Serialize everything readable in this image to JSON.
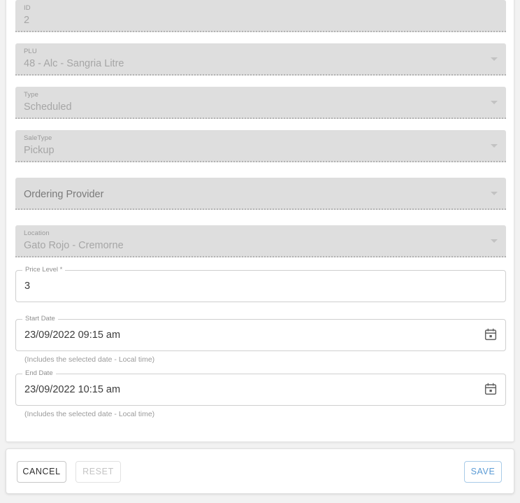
{
  "form": {
    "fields": [
      {
        "name": "id",
        "label": "ID",
        "value": "2",
        "type": "filled",
        "disabled": true,
        "arrow": false
      },
      {
        "name": "plu",
        "label": "PLU",
        "value": "48 - Alc - Sangria Litre",
        "type": "filled",
        "disabled": true,
        "arrow": true
      },
      {
        "name": "type",
        "label": "Type",
        "value": "Scheduled",
        "type": "filled",
        "disabled": true,
        "arrow": true
      },
      {
        "name": "saletype",
        "label": "SaleType",
        "value": "Pickup",
        "type": "filled",
        "disabled": true,
        "arrow": true
      },
      {
        "name": "ordering-provider",
        "label": "",
        "value": "",
        "placeholder": "Ordering Provider",
        "type": "filled",
        "disabled": true,
        "arrow": true
      },
      {
        "name": "location",
        "label": "Location",
        "value": "Gato Rojo - Cremorne",
        "type": "filled",
        "disabled": true,
        "arrow": true
      }
    ],
    "price_level": {
      "label": "Price Level *",
      "value": "3"
    },
    "start_date": {
      "label": "Start Date",
      "value": "23/09/2022 09:15 am",
      "hint": "(Includes the selected date - Local time)",
      "icon": "calendar-icon"
    },
    "end_date": {
      "label": "End Date",
      "value": "23/09/2022 10:15 am",
      "hint": "(Includes the selected date - Local time)",
      "icon": "calendar-icon"
    }
  },
  "footer": {
    "cancel_label": "CANCEL",
    "reset_label": "RESET",
    "save_label": "SAVE",
    "save_color": "#5b9bd5",
    "reset_disabled": true
  }
}
